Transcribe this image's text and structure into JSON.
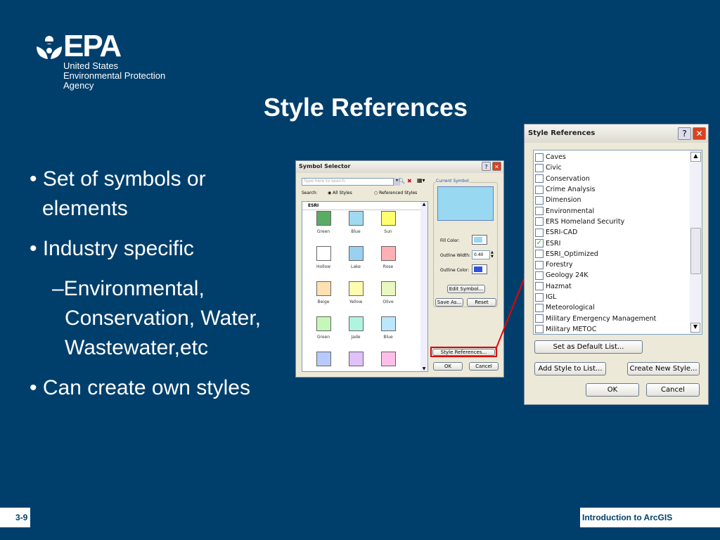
{
  "logo": {
    "wordmark": "EPA",
    "line1": "United States",
    "line2": "Environmental Protection",
    "line3": "Agency"
  },
  "title": "Style References",
  "bullets": [
    {
      "text": "Set of symbols or",
      "cont": "elements"
    },
    {
      "text": "Industry specific"
    },
    {
      "sub": "–Environmental,",
      "cont1": "Conservation, Water,",
      "cont2": "Wastewater,etc"
    },
    {
      "text": "Can create own styles"
    }
  ],
  "symbol_selector": {
    "title": "Symbol Selector",
    "search_placeholder": "Type here to search",
    "search_label": "Search:",
    "all_styles": "All Styles",
    "referenced_styles": "Referenced Styles",
    "group": "ESRI",
    "symbols": [
      {
        "name": "Green",
        "color": "#5aac64"
      },
      {
        "name": "Blue",
        "color": "#a0daf0"
      },
      {
        "name": "Sun",
        "color": "#ffff70"
      },
      {
        "name": "Hollow",
        "color": "#ffffff"
      },
      {
        "name": "Lake",
        "color": "#9ad0f0"
      },
      {
        "name": "Rose",
        "color": "#ffb0b4"
      },
      {
        "name": "Beige",
        "color": "#ffe0b0"
      },
      {
        "name": "Yellow",
        "color": "#fffcb0"
      },
      {
        "name": "Olive",
        "color": "#e8f8c0"
      },
      {
        "name": "Green",
        "color": "#c4f8b8"
      },
      {
        "name": "Jade",
        "color": "#b0f4e0"
      },
      {
        "name": "Blue",
        "color": "#bce6fc"
      },
      {
        "name": "",
        "color": "#b8cafc"
      },
      {
        "name": "",
        "color": "#e0c0f8"
      },
      {
        "name": "",
        "color": "#fcc0e8"
      }
    ],
    "current_symbol": "Current Symbol",
    "current_color": "#98d8f0",
    "fill_color": "Fill Color:",
    "outline_width": "Outline Width:",
    "outline_width_value": "0.40",
    "outline_color": "Outline Color:",
    "outline_color_value": "#3050e0",
    "edit_symbol": "Edit Symbol...",
    "save_as": "Save As...",
    "reset": "Reset",
    "style_references": "Style References...",
    "ok": "OK",
    "cancel": "Cancel"
  },
  "style_references": {
    "title": "Style References",
    "items": [
      {
        "label": "Caves",
        "checked": false
      },
      {
        "label": "Civic",
        "checked": false
      },
      {
        "label": "Conservation",
        "checked": false
      },
      {
        "label": "Crime Analysis",
        "checked": false
      },
      {
        "label": "Dimension",
        "checked": false
      },
      {
        "label": "Environmental",
        "checked": false
      },
      {
        "label": "ERS Homeland Security",
        "checked": false
      },
      {
        "label": "ESRI-CAD",
        "checked": false
      },
      {
        "label": "ESRI",
        "checked": true
      },
      {
        "label": "ESRI_Optimized",
        "checked": false
      },
      {
        "label": "Forestry",
        "checked": false
      },
      {
        "label": "Geology 24K",
        "checked": false
      },
      {
        "label": "Hazmat",
        "checked": false
      },
      {
        "label": "IGL",
        "checked": false
      },
      {
        "label": "Meteorological",
        "checked": false
      },
      {
        "label": "Military Emergency Management",
        "checked": false
      },
      {
        "label": "Military METOC",
        "checked": false
      }
    ],
    "set_default": "Set as Default List...",
    "add_style": "Add Style to List...",
    "create_style": "Create New Style...",
    "ok": "OK",
    "cancel": "Cancel"
  },
  "footer": {
    "page": "3-9",
    "course": "Introduction to ArcGIS"
  }
}
